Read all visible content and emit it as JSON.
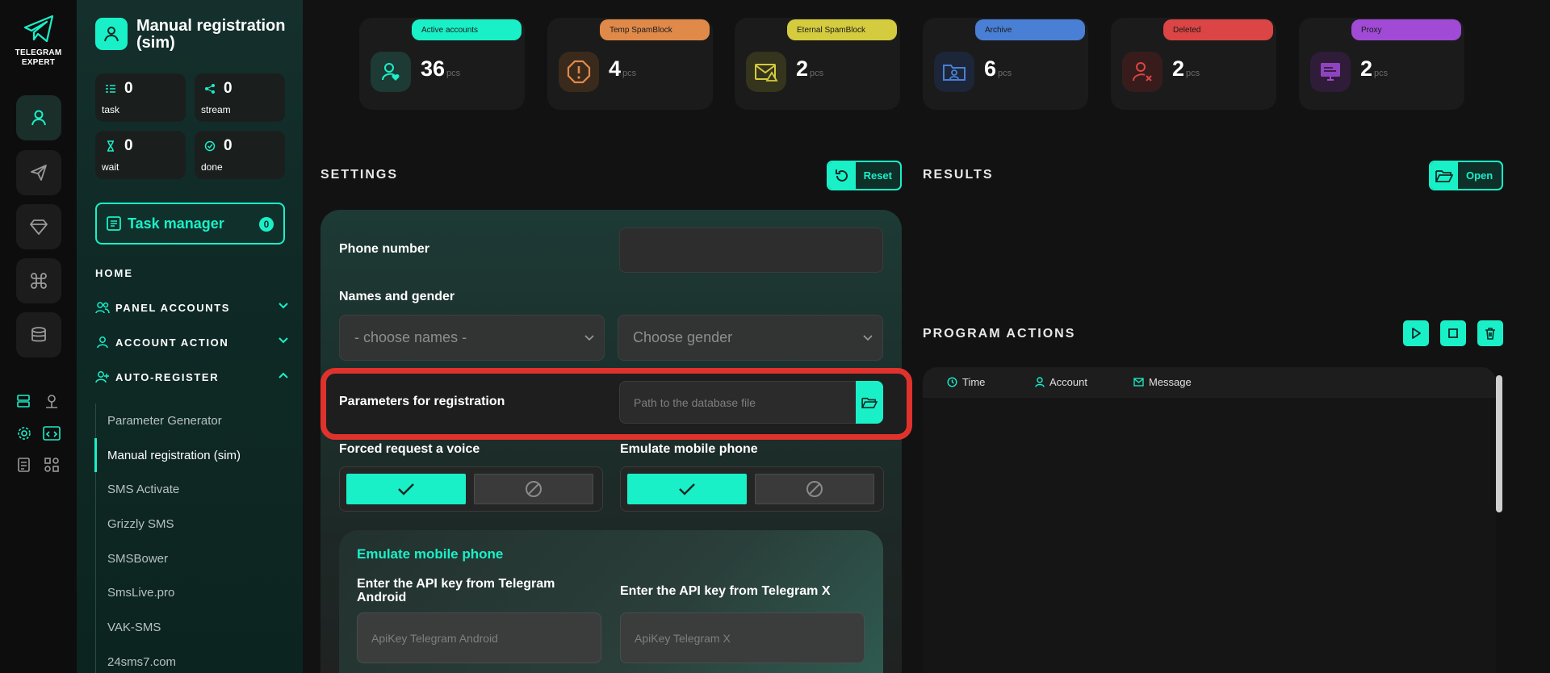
{
  "app": {
    "logo_line1": "TELEGRAM",
    "logo_line2": "EXPERT"
  },
  "sidebar": {
    "title": "Manual registration (sim)",
    "stats": [
      {
        "label": "task",
        "value": "0",
        "icon": "task-list-icon"
      },
      {
        "label": "stream",
        "value": "0",
        "icon": "share-nodes-icon"
      },
      {
        "label": "wait",
        "value": "0",
        "icon": "hourglass-icon"
      },
      {
        "label": "done",
        "value": "0",
        "icon": "check-circle-icon"
      }
    ],
    "task_manager": {
      "label": "Task manager",
      "count": "0"
    },
    "home": "HOME",
    "sections": [
      {
        "label": "PANEL ACCOUNTS",
        "expanded": false
      },
      {
        "label": "ACCOUNT ACTION",
        "expanded": false
      },
      {
        "label": "AUTO-REGISTER",
        "expanded": true
      }
    ],
    "items": [
      {
        "label": "Parameter Generator"
      },
      {
        "label": "Manual registration (sim)"
      },
      {
        "label": "SMS Activate"
      },
      {
        "label": "Grizzly SMS"
      },
      {
        "label": "SMSBower"
      },
      {
        "label": "SmsLive.pro"
      },
      {
        "label": "VAK-SMS"
      },
      {
        "label": "24sms7.com"
      }
    ]
  },
  "top_stats": [
    {
      "badge": "Active accounts",
      "value": "36",
      "unit": "pcs",
      "color": "#19f0c8"
    },
    {
      "badge": "Temp SpamBlock",
      "value": "4",
      "unit": "pcs",
      "color": "#e08a4a"
    },
    {
      "badge": "Eternal SpamBlock",
      "value": "2",
      "unit": "pcs",
      "color": "#d4cc3e"
    },
    {
      "badge": "Archive",
      "value": "6",
      "unit": "pcs",
      "color": "#4a7fd6"
    },
    {
      "badge": "Deleted",
      "value": "2",
      "unit": "pcs",
      "color": "#db4545"
    },
    {
      "badge": "Proxy",
      "value": "2",
      "unit": "pcs",
      "color": "#a04ad6"
    }
  ],
  "settings": {
    "title": "SETTINGS",
    "reset_label": "Reset",
    "phone_label": "Phone number",
    "phone_value": "",
    "names_gender_label": "Names and gender",
    "names_select": "- choose names -",
    "gender_select": "Choose gender",
    "params_label": "Parameters for registration",
    "params_placeholder": "Path to the database file",
    "forced_voice_label": "Forced request a voice",
    "emulate_label": "Emulate mobile phone",
    "emulate_card_title": "Emulate mobile phone",
    "api_android_label": "Enter the API key from Telegram Android",
    "api_android_placeholder": "ApiKey Telegram Android",
    "api_x_label": "Enter the API key from Telegram X",
    "api_x_placeholder": "ApiKey Telegram X"
  },
  "results": {
    "title": "RESULTS",
    "open_label": "Open"
  },
  "program_actions": {
    "title": "PROGRAM ACTIONS",
    "columns": [
      "Time",
      "Account",
      "Message"
    ]
  }
}
